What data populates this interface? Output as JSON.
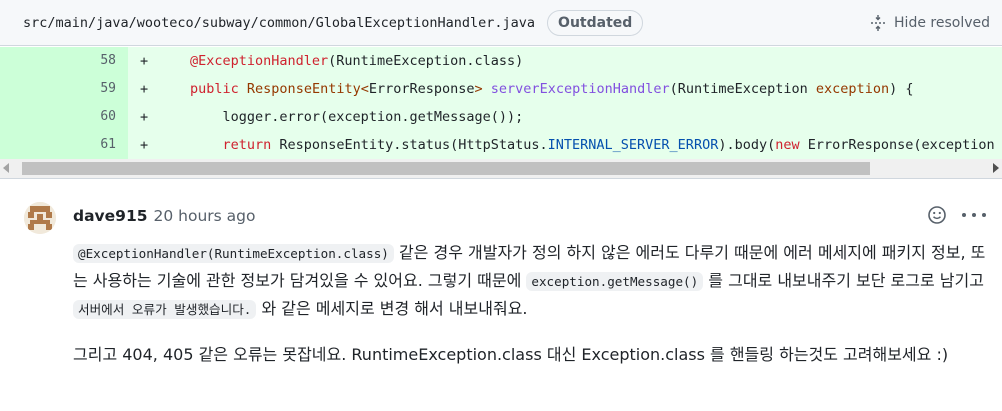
{
  "file": {
    "path": "src/main/java/wooteco/subway/common/GlobalExceptionHandler.java",
    "badge": "Outdated",
    "hide_resolved": "Hide resolved"
  },
  "diff": {
    "lines": [
      {
        "number": "58",
        "marker": "+"
      },
      {
        "number": "59",
        "marker": "+"
      },
      {
        "number": "60",
        "marker": "+"
      },
      {
        "number": "61",
        "marker": "+"
      }
    ],
    "code": {
      "l58_annotation": "@ExceptionHandler",
      "l58_rest": "(RuntimeException.class)",
      "l59_public": "public",
      "l59_type": "ResponseEntity<",
      "l59_arg": "ErrorResponse",
      "l59_close": ">",
      "l59_method": "serverExceptionHandler",
      "l59_paren": "(RuntimeException ",
      "l59_param": "exception",
      "l59_end": ") {",
      "l60_text": "logger.error(exception.getMessage());",
      "l61_return": "return",
      "l61_mid": " ResponseEntity.status(HttpStatus.",
      "l61_const": "INTERNAL_SERVER_ERROR",
      "l61_mid2": ").body(",
      "l61_new": "new",
      "l61_end": " ErrorResponse(exception"
    }
  },
  "comment": {
    "author": "dave915",
    "time": "20 hours ago",
    "p1_code1": "@ExceptionHandler(RuntimeException.class)",
    "p1_text1": " 같은 경우 개발자가 정의 하지 않은 에러도 다루기 때문에 에러 메세지에 패키지 정보, 또는 사용하는 기술에 관한 정보가 담겨있을 수 있어요. 그렇기 때문에 ",
    "p1_code2": "exception.getMessage()",
    "p1_text2": " 를 그대로 내보내주기 보단 로그로 남기고 ",
    "p1_code3": "서버에서 오류가 발생했습니다.",
    "p1_text3": " 와 같은 메세지로 변경 해서 내보내줘요.",
    "p2": "그리고 404, 405 같은 오류는 못잡네요. RuntimeException.class 대신 Exception.class 를 핸들링 하는것도 고려해보세요 :)"
  }
}
